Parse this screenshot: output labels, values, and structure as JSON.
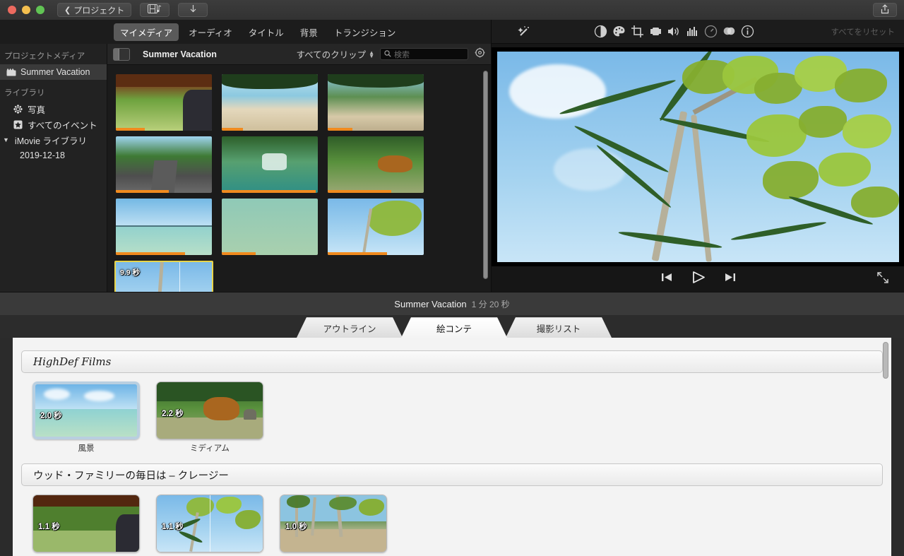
{
  "window": {
    "traffic_lights": [
      "close",
      "minimize",
      "zoom"
    ],
    "back_button": "プロジェクト",
    "back_chevron": "chevron-left-icon",
    "media_button_icon": "film-music-icon",
    "download_button_icon": "download-arrow-icon",
    "share_button_icon": "share-icon"
  },
  "media_tabs": {
    "items": [
      {
        "label": "マイメディア",
        "selected": true
      },
      {
        "label": "オーディオ",
        "selected": false
      },
      {
        "label": "タイトル",
        "selected": false
      },
      {
        "label": "背景",
        "selected": false
      },
      {
        "label": "トランジション",
        "selected": false
      }
    ]
  },
  "viewer_toolbar": {
    "enhance_icon": "magic-wand-icon",
    "tools": [
      {
        "name": "color-balance-icon"
      },
      {
        "name": "color-correction-icon"
      },
      {
        "name": "crop-icon"
      },
      {
        "name": "stabilization-icon"
      },
      {
        "name": "volume-icon"
      },
      {
        "name": "equalizer-icon"
      },
      {
        "name": "speed-icon"
      },
      {
        "name": "filter-icon"
      },
      {
        "name": "info-icon"
      }
    ],
    "reset_label": "すべてをリセット"
  },
  "sidebar": {
    "project_media_header": "プロジェクトメディア",
    "project_media_item": {
      "label": "Summer Vacation",
      "icon": "clapperboard-icon",
      "selected": true
    },
    "library_header": "ライブラリ",
    "items": [
      {
        "label": "写真",
        "icon": "photos-icon"
      },
      {
        "label": "すべてのイベント",
        "icon": "star-events-icon"
      }
    ],
    "library_root": {
      "label": "iMovie ライブラリ",
      "expanded": true,
      "disclosure": "▼"
    },
    "library_children": [
      {
        "label": "2019-12-18"
      }
    ]
  },
  "browser_header": {
    "sidebar_toggle_icon": "sidebar-toggle-icon",
    "title": "Summer Vacation",
    "filter_label": "すべてのクリップ",
    "filter_stepper_icon": "stepper-updown-icon",
    "search_icon": "search-icon",
    "search_placeholder": "検索",
    "search_value": "",
    "settings_icon": "gear-icon"
  },
  "browser_grid": {
    "clips": [
      {
        "art": "bus",
        "used": 0.3,
        "duration": null,
        "selected": false
      },
      {
        "art": "sandbeach",
        "used": 0.22,
        "duration": null,
        "selected": false
      },
      {
        "art": "shore",
        "used": 0.26,
        "duration": null,
        "selected": false
      },
      {
        "art": "road",
        "used": 0.55,
        "duration": null,
        "selected": false
      },
      {
        "art": "falls",
        "used": 0.98,
        "duration": null,
        "selected": false
      },
      {
        "art": "cowfield",
        "used": 0.66,
        "duration": null,
        "selected": false
      },
      {
        "art": "sea",
        "used": 0.72,
        "duration": null,
        "selected": false
      },
      {
        "art": "sea2",
        "used": 0.35,
        "duration": null,
        "selected": false
      },
      {
        "art": "palmsky",
        "used": 0.62,
        "duration": null,
        "selected": false
      },
      {
        "art": "palmsky2",
        "used": 0.0,
        "duration": "9.9 秒",
        "selected": true
      }
    ],
    "scrollbar": "vertical-scrollbar"
  },
  "viewer": {
    "frame_description": "palm-trees-sky",
    "controls": {
      "previous_icon": "skip-previous-icon",
      "play_icon": "play-icon",
      "next_icon": "skip-next-icon",
      "fullscreen_icon": "fullscreen-icon"
    }
  },
  "project_bar": {
    "name": "Summer Vacation",
    "duration": "1 分 20 秒"
  },
  "board_tabs": {
    "items": [
      {
        "label": "アウトライン",
        "selected": false
      },
      {
        "label": "絵コンテ",
        "selected": true
      },
      {
        "label": "撮影リスト",
        "selected": false
      }
    ]
  },
  "storyboard": {
    "brand_banner": "HighDef Films",
    "sections": [
      {
        "title": null,
        "clips": [
          {
            "duration": "2.0 秒",
            "label": "風景",
            "art": "sea",
            "selected": true,
            "split": false
          },
          {
            "duration": "2.2 秒",
            "label": "ミディアム",
            "art": "cowfield",
            "selected": false,
            "split": false
          }
        ]
      },
      {
        "title": "ウッド・ファミリーの毎日は – クレージー",
        "clips": [
          {
            "duration": "1.1 秒",
            "label": "",
            "art": "bus",
            "selected": false,
            "split": false
          },
          {
            "duration": "1.1 秒",
            "label": "",
            "art": "palmsky",
            "selected": false,
            "split": true
          },
          {
            "duration": "1.0 秒",
            "label": "",
            "art": "shore",
            "selected": false,
            "split": false
          }
        ]
      }
    ],
    "scrollbar": "vertical-scrollbar"
  },
  "colors": {
    "accent_orange": "#f08a1e",
    "selection_yellow": "#e8d44a",
    "selection_blue": "#b9cfe0",
    "chrome_dark": "#1c1c1c",
    "board_bg": "#f3f3f3"
  }
}
